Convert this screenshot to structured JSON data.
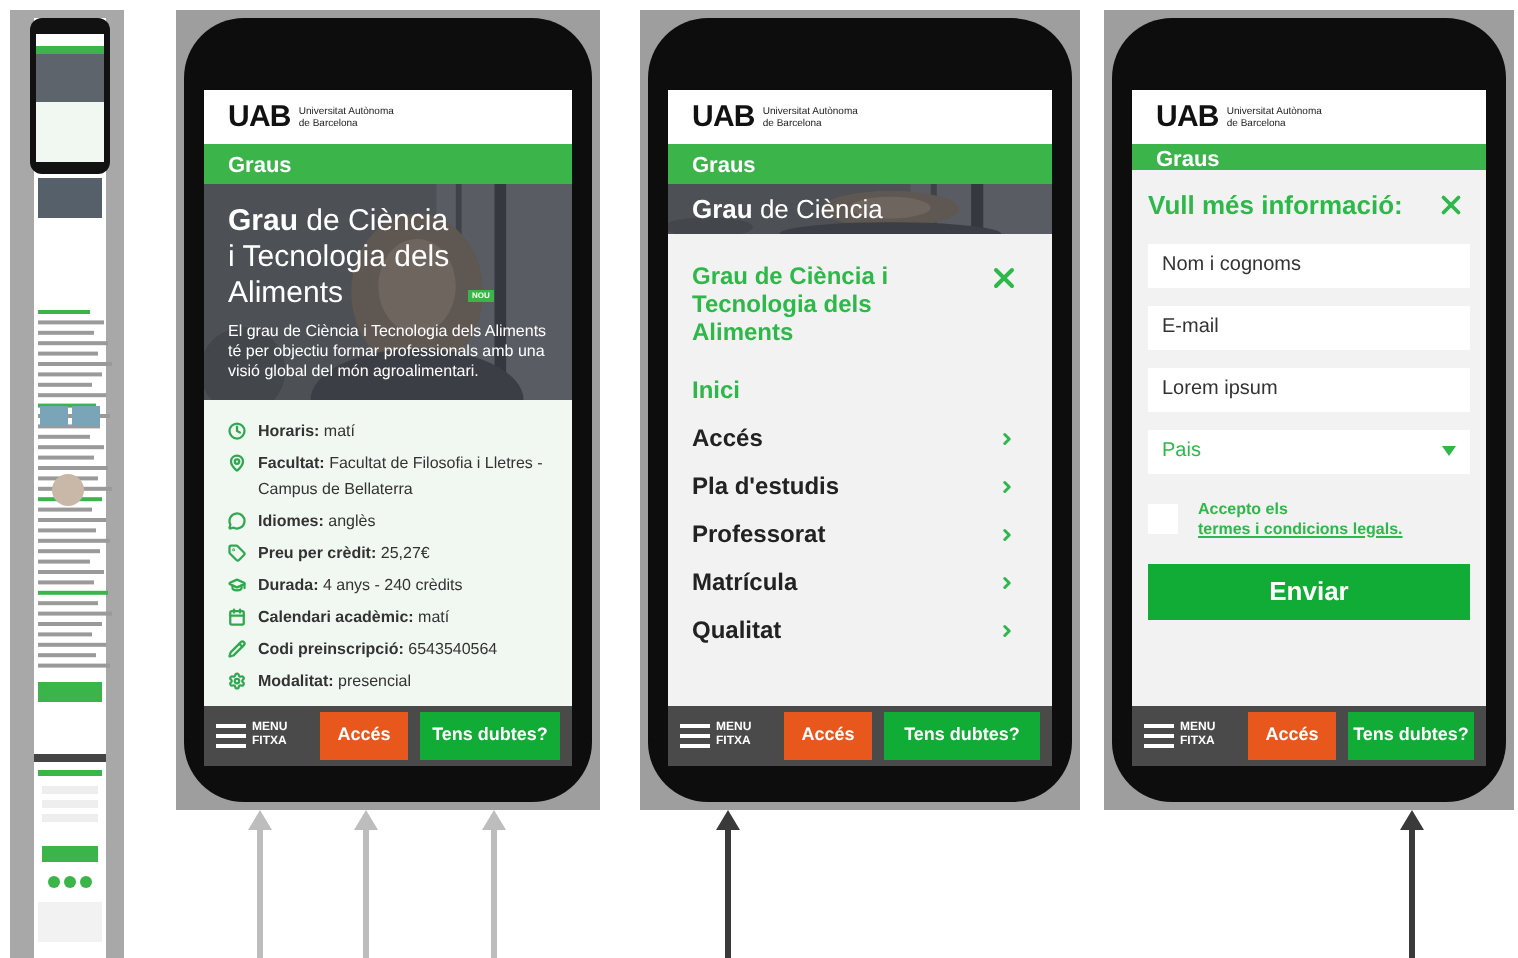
{
  "screens": [
    {
      "kind": "detail",
      "logo": "UAB",
      "institution": [
        "Universitat Autònoma",
        "de Barcelona"
      ],
      "section": "Graus",
      "hero": {
        "title": "**Grau** de Ciència i Tecnologia dels Aliments",
        "badge": "NOU",
        "description": "El grau de Ciència i Tecnologia dels Aliments té per objectiu formar professionals amb una visió global del món agroalimentari."
      },
      "facts": [
        {
          "label": "Horaris:",
          "value": "matí"
        },
        {
          "label": "Facultat:",
          "value": "Facultat de Filosofia i Lletres - Campus de Bellaterra"
        },
        {
          "label": "Idiomes:",
          "value": "anglès"
        },
        {
          "label": "Preu per crèdit:",
          "value": "25,27€"
        },
        {
          "label": "Durada:",
          "value": "4 anys - 240 crèdits"
        },
        {
          "label": "Calendari acadèmic:",
          "value": "matí"
        },
        {
          "label": "Codi preinscripció:",
          "value": "6543540564"
        },
        {
          "label": "Modalitat:",
          "value": "presencial"
        }
      ],
      "bottom_bar": {
        "menu": {
          "label": [
            "MENU",
            "FITXA"
          ],
          "pointed": true,
          "pointer_dark": false
        },
        "buttons": [
          {
            "label": "Accés",
            "pointed": true,
            "pointer_dark": false
          },
          {
            "label": "Tens dubtes?",
            "pointed": true,
            "pointer_dark": false
          }
        ]
      }
    },
    {
      "kind": "menu",
      "logo": "UAB",
      "institution": [
        "Universitat Autònoma",
        "de Barcelona"
      ],
      "section": "Graus",
      "hero": {
        "title": "**Grau** de Ciència"
      },
      "menu": {
        "title": "Grau de Ciència i Tecnologia dels Aliments",
        "items": [
          {
            "label": "Inici",
            "selected": true
          },
          {
            "label": "Accés",
            "selected": false
          },
          {
            "label": "Pla d'estudis",
            "selected": false
          },
          {
            "label": "Professorat",
            "selected": false
          },
          {
            "label": "Matrícula",
            "selected": false
          },
          {
            "label": "Qualitat",
            "selected": false
          }
        ]
      },
      "bottom_bar": {
        "menu": {
          "label": [
            "MENU",
            "FITXA"
          ],
          "pointed": true,
          "pointer_dark": true
        },
        "buttons": [
          {
            "label": "Accés",
            "pointed": false
          },
          {
            "label": "Tens dubtes?",
            "pointed": false
          }
        ]
      }
    },
    {
      "kind": "form",
      "logo": "UAB",
      "institution": [
        "Universitat Autònoma",
        "de Barcelona"
      ],
      "section": "Graus",
      "form": {
        "title": "Vull més informació:",
        "fields": [
          {
            "placeholder": "Nom i cognoms"
          },
          {
            "placeholder": "E-mail"
          },
          {
            "placeholder": "Lorem ipsum"
          }
        ],
        "select": {
          "placeholder": "Pais"
        },
        "consent": {
          "checked": false,
          "text": "Accepto els",
          "link": "termes i condicions legals."
        },
        "submit": "Enviar"
      },
      "bottom_bar": {
        "menu": {
          "label": [
            "MENU",
            "FITXA"
          ],
          "pointed": false
        },
        "buttons": [
          {
            "label": "Accés",
            "pointed": false
          },
          {
            "label": "Tens dubtes?",
            "pointed": true,
            "pointer_dark": true
          }
        ]
      }
    }
  ]
}
